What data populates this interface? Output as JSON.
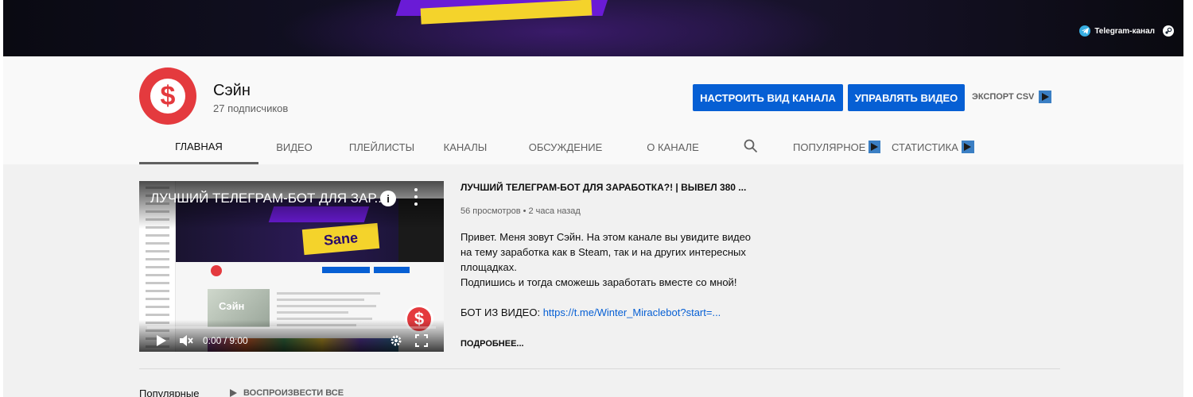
{
  "banner": {
    "links": [
      {
        "label": "Telegram-канал",
        "icon": "telegram-icon"
      },
      {
        "label": "",
        "icon": "steam-icon"
      }
    ]
  },
  "channel": {
    "name": "Сэйн",
    "subscribers": "27 подписчиков",
    "avatar_symbol": "$",
    "avatar_color": "#e43a3e"
  },
  "actions": {
    "customize": "НАСТРОИТЬ ВИД КАНАЛА",
    "manage": "УПРАВЛЯТЬ ВИДЕО",
    "export": "ЭКСПОРТ CSV",
    "accent": "#065fd4"
  },
  "tabs": [
    {
      "label": "ГЛАВНАЯ",
      "active": true
    },
    {
      "label": "ВИДЕО"
    },
    {
      "label": "ПЛЕЙЛИСТЫ"
    },
    {
      "label": "КАНАЛЫ"
    },
    {
      "label": "ОБСУЖДЕНИЕ"
    },
    {
      "label": "О КАНАЛЕ"
    },
    {
      "label": "ПОПУЛЯРНОЕ"
    },
    {
      "label": "СТАТИСТИКА"
    }
  ],
  "featured": {
    "overlay_title": "ЛУЧШИЙ ТЕЛЕГРАМ-БОТ ДЛЯ ЗАР...",
    "thumb_logo_text": "Sane",
    "thumb_card_text": "Сэйн",
    "time": "0:00 / 9:00",
    "title": "ЛУЧШИЙ ТЕЛЕГРАМ-БОТ ДЛЯ ЗАРАБОТКА?! | ВЫВЕЛ 380 ...",
    "meta": "56 просмотров • 2 часа назад",
    "description": [
      "Привет. Меня зовут Сэйн. На этом канале вы увидите видео",
      "на тему заработка как в Steam, так и на других интересных",
      "площадках.",
      "Подпишись и тогда сможешь заработать вместе со мной!",
      ""
    ],
    "bot_label": "БОТ ИЗ ВИДЕО: ",
    "bot_link": "https://t.me/Winter_Miraclebot?start=...",
    "more": "ПОДРОБНЕЕ..."
  },
  "shelf": {
    "title": "Популярные",
    "play_all": "ВОСПРОИЗВЕСТИ ВСЕ"
  }
}
